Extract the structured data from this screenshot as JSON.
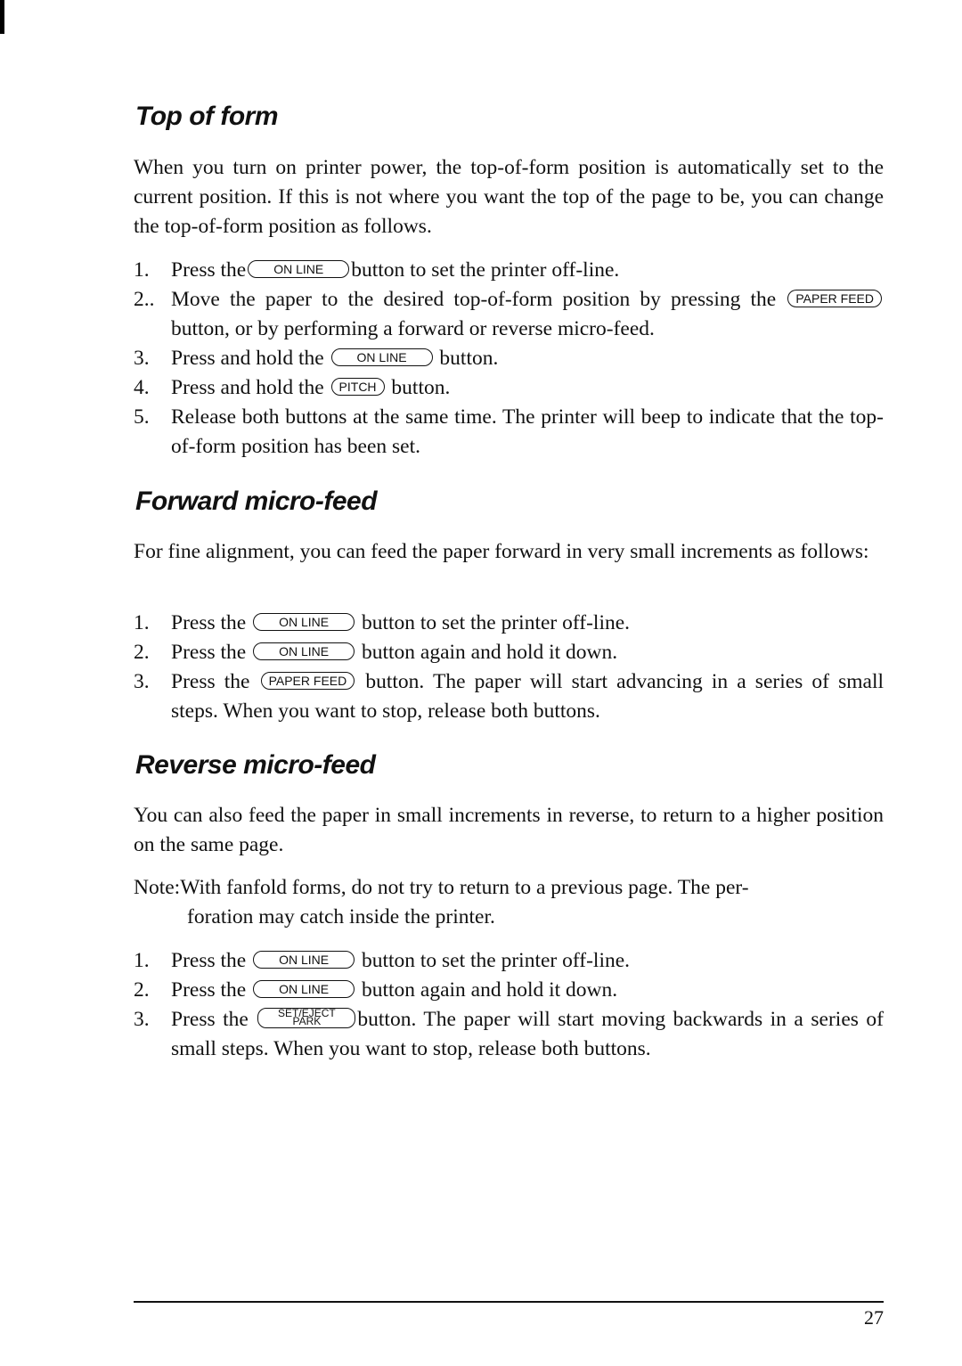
{
  "sections": [
    {
      "title": "Top of form",
      "intro": "When you turn on printer power, the top-of-form position is automatically set to the current position. If this is not where you want the top of the page to be, you can change the top-of-form position as follows.",
      "steps": [
        {
          "num": "1.",
          "before": "Press the",
          "key": "ON LINE",
          "after": "button to set the printer off-line."
        },
        {
          "num": "2..",
          "before": "Move the paper to the desired top-of-form position by pressing the",
          "key": "PAPER FEED",
          "after": "button, or by performing a forward or reverse micro-feed."
        },
        {
          "num": "3.",
          "before": "Press and hold the",
          "key": "ON LINE",
          "after": "button."
        },
        {
          "num": "4.",
          "before": "Press and hold the",
          "key": "PITCH",
          "after": "button."
        },
        {
          "num": "5.",
          "before": "Release both buttons at the same time. The printer will beep to indicate that the top-of-form position has been set.",
          "key": "",
          "after": ""
        }
      ]
    },
    {
      "title": "Forward micro-feed",
      "intro": "For fine alignment, you can feed the paper forward in very small increments as follows:",
      "steps": [
        {
          "num": "1.",
          "before": "Press the",
          "key": "ON LINE",
          "after": "button to set the printer off-line."
        },
        {
          "num": "2.",
          "before": "Press the",
          "key": "ON LINE",
          "after": "button again and hold it down."
        },
        {
          "num": "3.",
          "before": "Press the",
          "key": "PAPER FEED",
          "after": "button. The paper will start advancing in a series of small steps. When you want to stop, release both buttons."
        }
      ]
    },
    {
      "title": "Reverse micro-feed",
      "intro": "You can also feed the paper in small increments in reverse, to return to a higher position on the same page.",
      "note": {
        "label": "Note:",
        "text": "With fanfold forms, do not try to return to a previous page. The per-",
        "continuation": "foration may catch inside the printer."
      },
      "steps": [
        {
          "num": "1.",
          "before": "Press the",
          "key": "ON LINE",
          "after": "button to set the printer off-line."
        },
        {
          "num": "2.",
          "before": "Press the",
          "key": "ON LINE",
          "after": "button again and hold it down."
        },
        {
          "num": "3.",
          "before": "Press the",
          "key_top": "SET/EJECT",
          "key_bottom": "PARK",
          "after": "button. The paper will start moving backwards in a series of small steps. When you want to stop, release both buttons."
        }
      ]
    }
  ],
  "footer": {
    "page_number": "27"
  }
}
